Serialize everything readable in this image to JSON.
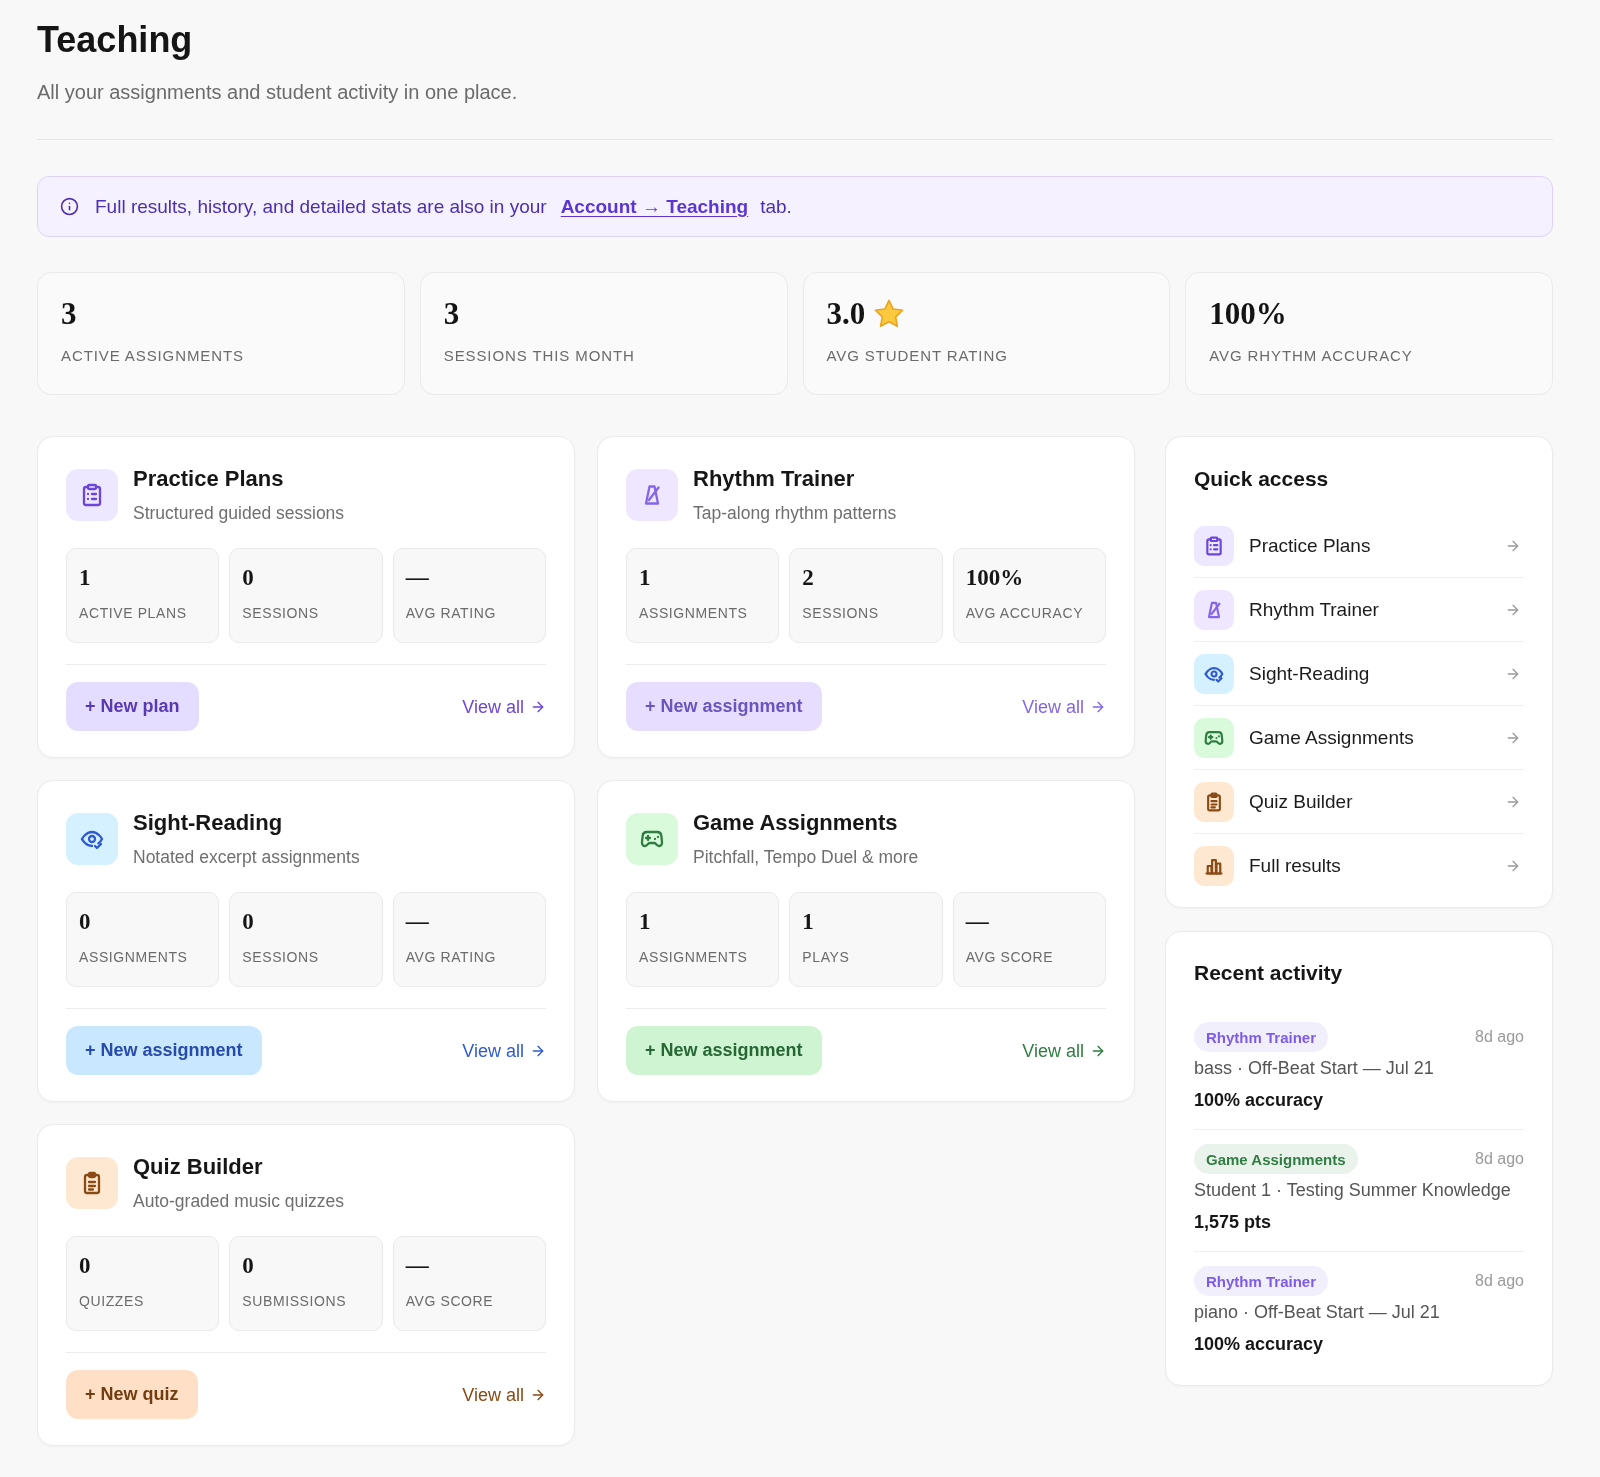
{
  "header": {
    "title": "Teaching",
    "subtitle": "All your assignments and student activity in one place."
  },
  "notice": {
    "text_before": "Full results, history, and detailed stats are also in your",
    "link": "Account → Teaching",
    "text_after": "tab."
  },
  "stats": [
    {
      "kind": "count",
      "value": "3",
      "label": "ACTIVE ASSIGNMENTS"
    },
    {
      "kind": "count",
      "value": "3",
      "label": "SESSIONS THIS MONTH"
    },
    {
      "kind": "rating",
      "value": "3.0",
      "label": "AVG STUDENT RATING"
    },
    {
      "kind": "percent",
      "value": "100%",
      "label": "AVG RHYTHM ACCURACY"
    }
  ],
  "sections": [
    {
      "title": "Practice Plans",
      "subtitle": "Structured guided sessions",
      "color": "#6b46d9",
      "metrics": [
        {
          "value": "1",
          "label": "ACTIVE PLANS"
        },
        {
          "value": "0",
          "label": "SESSIONS"
        },
        {
          "value": "—",
          "label": "AVG RATING"
        }
      ],
      "action": "+ New plan",
      "link": "View all"
    },
    {
      "title": "Rhythm Trainer",
      "subtitle": "Tap-along rhythm patterns",
      "color": "#8466e6",
      "metrics": [
        {
          "value": "1",
          "label": "ASSIGNMENTS"
        },
        {
          "value": "2",
          "label": "SESSIONS"
        },
        {
          "value": "100%",
          "label": "AVG ACCURACY"
        }
      ],
      "action": "+ New assignment",
      "link": "View all"
    },
    {
      "title": "Sight-Reading",
      "subtitle": "Notated excerpt assignments",
      "color": "#2f5bcf",
      "metrics": [
        {
          "value": "0",
          "label": "ASSIGNMENTS"
        },
        {
          "value": "0",
          "label": "SESSIONS"
        },
        {
          "value": "—",
          "label": "AVG RATING"
        }
      ],
      "action": "+ New assignment",
      "link": "View all"
    },
    {
      "title": "Game Assignments",
      "subtitle": "Pitchfall, Tempo Duel & more",
      "color": "#2f7d40",
      "metrics": [
        {
          "value": "1",
          "label": "ASSIGNMENTS"
        },
        {
          "value": "1",
          "label": "PLAYS"
        },
        {
          "value": "—",
          "label": "AVG SCORE"
        }
      ],
      "action": "+ New assignment",
      "link": "View all"
    },
    {
      "title": "Quiz Builder",
      "subtitle": "Auto-graded music quizzes",
      "color": "#8a4a14",
      "metrics": [
        {
          "value": "0",
          "label": "QUIZZES"
        },
        {
          "value": "0",
          "label": "SUBMISSIONS"
        },
        {
          "value": "—",
          "label": "AVG SCORE"
        }
      ],
      "action": "+ New quiz",
      "link": "View all"
    }
  ],
  "quick_access": {
    "title": "Quick access",
    "items": [
      {
        "label": "Practice Plans",
        "color": "#6b46d9"
      },
      {
        "label": "Rhythm Trainer",
        "color": "#8466e6"
      },
      {
        "label": "Sight-Reading",
        "color": "#2f5bcf"
      },
      {
        "label": "Game Assignments",
        "color": "#2f7d40"
      },
      {
        "label": "Quiz Builder",
        "color": "#8a4a14"
      },
      {
        "label": "Full results",
        "color": "#8a4a14"
      }
    ]
  },
  "recent_activity": {
    "title": "Recent activity",
    "items": [
      {
        "tag": "Rhythm Trainer",
        "color": "#7c5ce6",
        "time": "8d ago",
        "detail": "bass · Off-Beat Start — Jul 21",
        "result": "100% accuracy"
      },
      {
        "tag": "Game Assignments",
        "color": "#2f7d40",
        "time": "8d ago",
        "detail": "Student 1 · Testing Summer Knowledge",
        "result": "1,575 pts"
      },
      {
        "tag": "Rhythm Trainer",
        "color": "#7c5ce6",
        "time": "8d ago",
        "detail": "piano · Off-Beat Start — Jul 21",
        "result": "100% accuracy"
      }
    ]
  }
}
